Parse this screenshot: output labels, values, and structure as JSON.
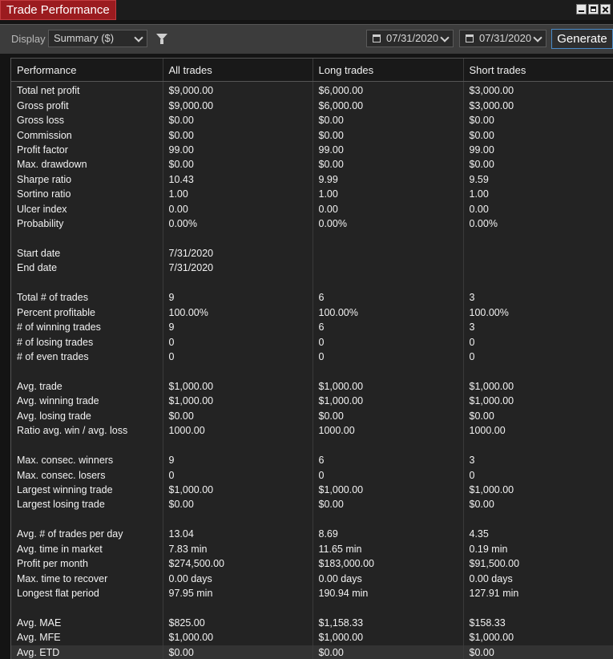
{
  "window": {
    "title": "Trade Performance"
  },
  "toolbar": {
    "display_label": "Display",
    "display_value": "Summary ($)",
    "date_from": "07/31/2020",
    "date_to": "07/31/2020",
    "generate_label": "Generate"
  },
  "table": {
    "headers": [
      "Performance",
      "All trades",
      "Long trades",
      "Short trades"
    ],
    "rows": [
      [
        "Total net profit",
        "$9,000.00",
        "$6,000.00",
        "$3,000.00"
      ],
      [
        "Gross profit",
        "$9,000.00",
        "$6,000.00",
        "$3,000.00"
      ],
      [
        "Gross loss",
        "$0.00",
        "$0.00",
        "$0.00"
      ],
      [
        "Commission",
        "$0.00",
        "$0.00",
        "$0.00"
      ],
      [
        "Profit factor",
        "99.00",
        "99.00",
        "99.00"
      ],
      [
        "Max. drawdown",
        "$0.00",
        "$0.00",
        "$0.00"
      ],
      [
        "Sharpe ratio",
        "10.43",
        "9.99",
        "9.59"
      ],
      [
        "Sortino ratio",
        "1.00",
        "1.00",
        "1.00"
      ],
      [
        "Ulcer index",
        "0.00",
        "0.00",
        "0.00"
      ],
      [
        "Probability",
        "0.00%",
        "0.00%",
        "0.00%"
      ],
      [
        "",
        "",
        "",
        ""
      ],
      [
        "Start date",
        "7/31/2020",
        "",
        ""
      ],
      [
        "End date",
        "7/31/2020",
        "",
        ""
      ],
      [
        "",
        "",
        "",
        ""
      ],
      [
        "Total # of trades",
        "9",
        "6",
        "3"
      ],
      [
        "Percent profitable",
        "100.00%",
        "100.00%",
        "100.00%"
      ],
      [
        "# of winning trades",
        "9",
        "6",
        "3"
      ],
      [
        "# of losing trades",
        "0",
        "0",
        "0"
      ],
      [
        "# of even trades",
        "0",
        "0",
        "0"
      ],
      [
        "",
        "",
        "",
        ""
      ],
      [
        "Avg. trade",
        "$1,000.00",
        "$1,000.00",
        "$1,000.00"
      ],
      [
        "Avg. winning trade",
        "$1,000.00",
        "$1,000.00",
        "$1,000.00"
      ],
      [
        "Avg. losing trade",
        "$0.00",
        "$0.00",
        "$0.00"
      ],
      [
        "Ratio avg. win / avg. loss",
        "1000.00",
        "1000.00",
        "1000.00"
      ],
      [
        "",
        "",
        "",
        ""
      ],
      [
        "Max. consec. winners",
        "9",
        "6",
        "3"
      ],
      [
        "Max. consec. losers",
        "0",
        "0",
        "0"
      ],
      [
        "Largest winning trade",
        "$1,000.00",
        "$1,000.00",
        "$1,000.00"
      ],
      [
        "Largest losing trade",
        "$0.00",
        "$0.00",
        "$0.00"
      ],
      [
        "",
        "",
        "",
        ""
      ],
      [
        "Avg. # of trades per day",
        "13.04",
        "8.69",
        "4.35"
      ],
      [
        "Avg. time in market",
        "7.83 min",
        "11.65 min",
        "0.19 min"
      ],
      [
        "Profit per month",
        "$274,500.00",
        "$183,000.00",
        "$91,500.00"
      ],
      [
        "Max. time to recover",
        "0.00 days",
        "0.00 days",
        "0.00 days"
      ],
      [
        "Longest flat period",
        "97.95 min",
        "190.94 min",
        "127.91 min"
      ],
      [
        "",
        "",
        "",
        ""
      ],
      [
        "Avg. MAE",
        "$825.00",
        "$1,158.33",
        "$158.33"
      ],
      [
        "Avg. MFE",
        "$1,000.00",
        "$1,000.00",
        "$1,000.00"
      ],
      [
        "Avg. ETD",
        "$0.00",
        "$0.00",
        "$0.00"
      ]
    ]
  }
}
